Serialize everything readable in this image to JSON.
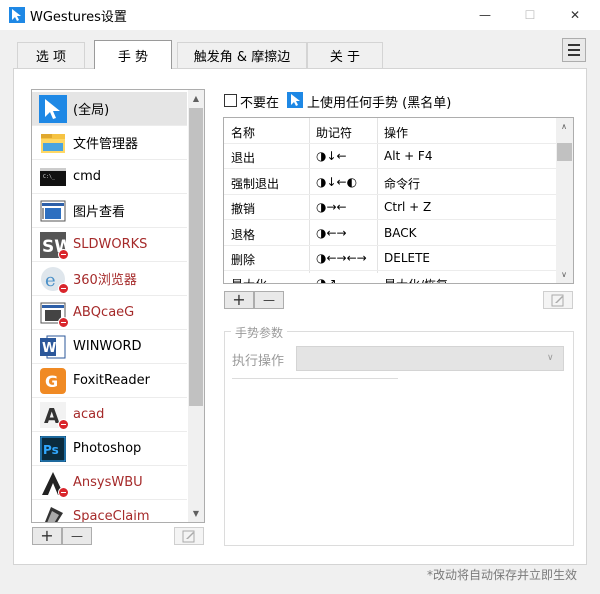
{
  "window": {
    "title": "WGestures设置",
    "controls": {
      "minimize": "—",
      "maximize": "☐",
      "close": "✕"
    }
  },
  "tabs": [
    {
      "label": "选 项",
      "active": false
    },
    {
      "label": "手 势",
      "active": true
    },
    {
      "label": "触发角 & 摩擦边",
      "active": false
    },
    {
      "label": "关 于",
      "active": false
    }
  ],
  "app_list": {
    "items": [
      {
        "label": "(全局)",
        "icon": "cursor-icon",
        "blacklisted": false,
        "selected": true
      },
      {
        "label": "文件管理器",
        "icon": "folder-icon",
        "blacklisted": false
      },
      {
        "label": "cmd",
        "icon": "terminal-icon",
        "blacklisted": false
      },
      {
        "label": "图片查看",
        "icon": "image-viewer-icon",
        "blacklisted": false
      },
      {
        "label": "SLDWORKS",
        "icon": "solidworks-icon",
        "blacklisted": true
      },
      {
        "label": "360浏览器",
        "icon": "browser-360-icon",
        "blacklisted": true
      },
      {
        "label": "ABQcaeG",
        "icon": "abaqus-icon",
        "blacklisted": true
      },
      {
        "label": "WINWORD",
        "icon": "word-icon",
        "blacklisted": false
      },
      {
        "label": "FoxitReader",
        "icon": "foxit-icon",
        "blacklisted": false
      },
      {
        "label": "acad",
        "icon": "autocad-icon",
        "blacklisted": true
      },
      {
        "label": "Photoshop",
        "icon": "photoshop-icon",
        "blacklisted": false
      },
      {
        "label": "AnsysWBU",
        "icon": "ansys-icon",
        "blacklisted": true
      },
      {
        "label": "SpaceClaim",
        "icon": "spaceclaim-icon",
        "blacklisted": true
      }
    ],
    "add_label": "+",
    "remove_label": "—"
  },
  "blacklist": {
    "checked": false,
    "label_before": "不要在",
    "label_after": "上使用任何手势 (黑名单)"
  },
  "gesture_table": {
    "headers": [
      "名称",
      "助记符",
      "操作"
    ],
    "rows": [
      {
        "name": "退出",
        "mnemonic": "◑↓←",
        "action": "Alt + F4"
      },
      {
        "name": "强制退出",
        "mnemonic": "◑↓←◐",
        "action": "命令行"
      },
      {
        "name": "撤销",
        "mnemonic": "◑→←",
        "action": "Ctrl + Z"
      },
      {
        "name": "退格",
        "mnemonic": "◑←→",
        "action": "BACK"
      },
      {
        "name": "删除",
        "mnemonic": "◑←→←→",
        "action": "DELETE"
      },
      {
        "name": "最大化",
        "mnemonic": "◑↗",
        "action": "最大化/恢复"
      }
    ],
    "add_label": "+",
    "remove_label": "—"
  },
  "params": {
    "title": "手势参数",
    "exec_label": "执行操作",
    "exec_value": ""
  },
  "footer": {
    "note": "*改动将自动保存并立即生效"
  },
  "colors": {
    "blacklisted_text": "#a52a2a",
    "block_badge": "#d9262c",
    "selected_row": "#e5e5e5"
  }
}
